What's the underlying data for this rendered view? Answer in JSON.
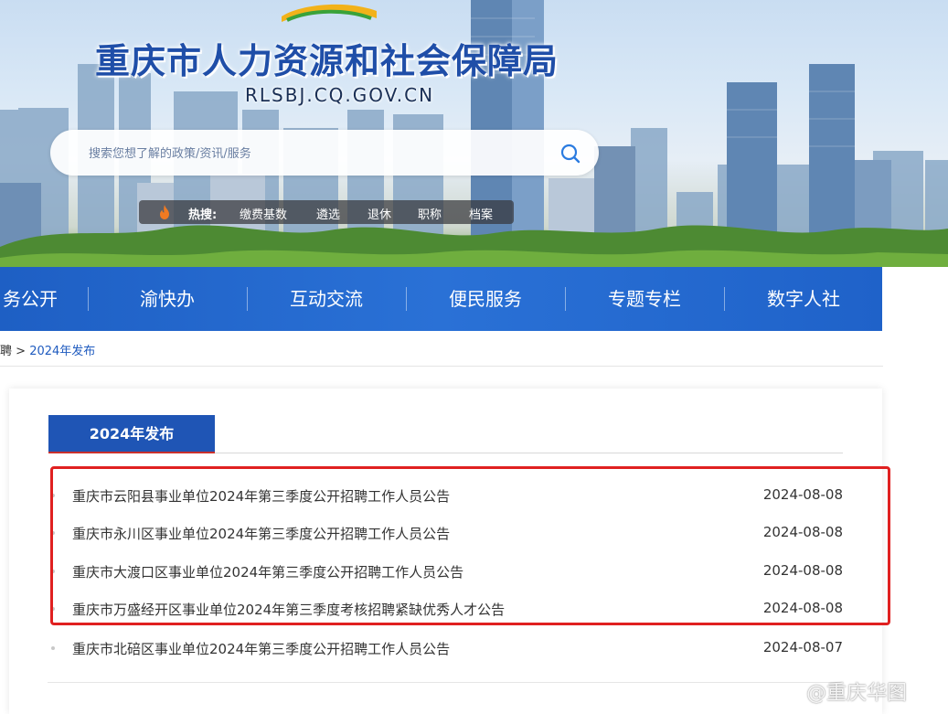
{
  "site": {
    "title": "重庆市人力资源和社会保障局",
    "domain": "RLSBJ.CQ.GOV.CN"
  },
  "search": {
    "placeholder": "搜索您想了解的政策/资讯/服务"
  },
  "hot": {
    "label": "热搜:",
    "items": [
      "缴费基数",
      "遴选",
      "退休",
      "职称",
      "档案"
    ]
  },
  "nav": {
    "items": [
      "务公开",
      "渝快办",
      "互动交流",
      "便民服务",
      "专题专栏",
      "数字人社"
    ]
  },
  "breadcrumb": {
    "parent": "招聘",
    "separator": ">",
    "current": "2024年发布"
  },
  "panel": {
    "tab_label": "2024年发布",
    "rows": [
      {
        "title": "重庆市云阳县事业单位2024年第三季度公开招聘工作人员公告",
        "date": "2024-08-08"
      },
      {
        "title": "重庆市永川区事业单位2024年第三季度公开招聘工作人员公告",
        "date": "2024-08-08"
      },
      {
        "title": "重庆市大渡口区事业单位2024年第三季度公开招聘工作人员公告",
        "date": "2024-08-08"
      },
      {
        "title": "重庆市万盛经开区事业单位2024年第三季度考核招聘紧缺优秀人才公告",
        "date": "2024-08-08"
      },
      {
        "title": "重庆市北碚区事业单位2024年第三季度公开招聘工作人员公告",
        "date": "2024-08-07"
      }
    ]
  },
  "watermark": {
    "text": "@重庆华图"
  },
  "colors": {
    "brand_blue": "#1f55b5",
    "nav_blue": "#2a71d6",
    "highlight_red": "#e02020"
  }
}
